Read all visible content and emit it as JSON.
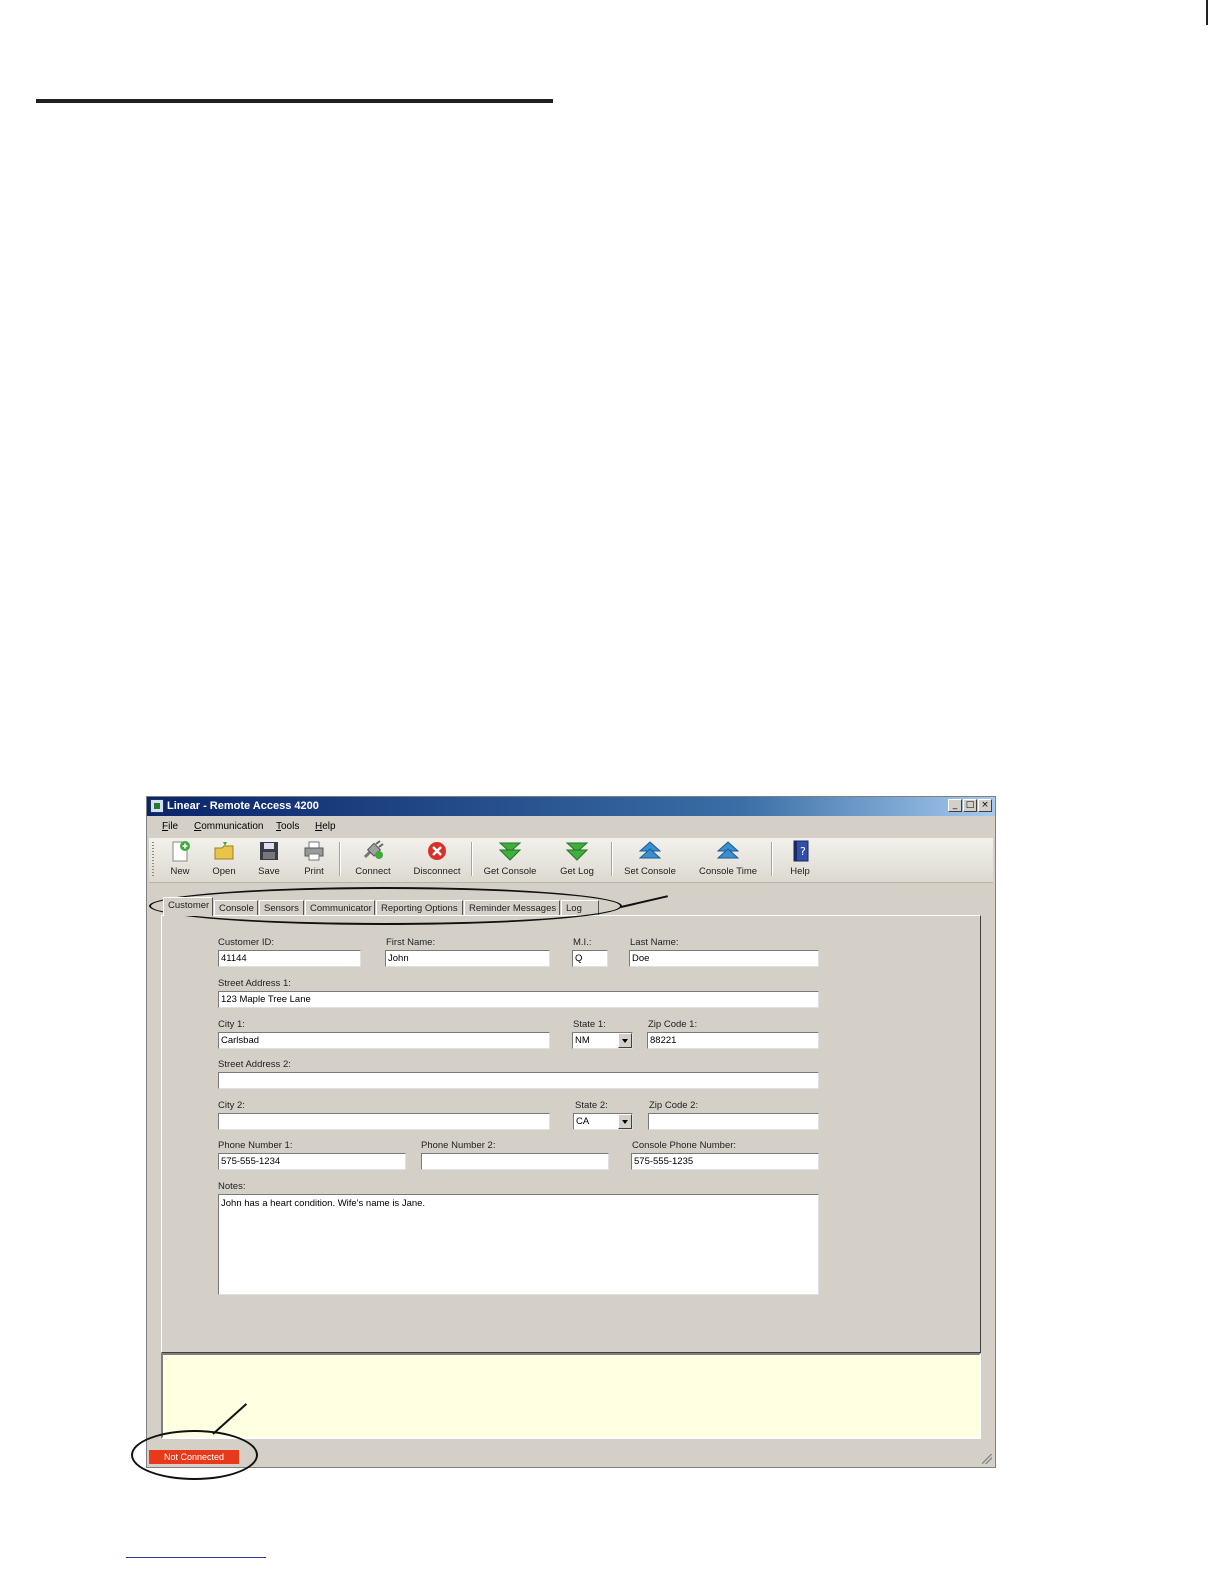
{
  "window": {
    "title": "Linear - Remote Access 4200"
  },
  "menu": [
    {
      "accel": "F",
      "rest": "ile"
    },
    {
      "accel": "C",
      "rest": "ommunication"
    },
    {
      "accel": "T",
      "rest": "ools"
    },
    {
      "accel": "H",
      "rest": "elp"
    }
  ],
  "toolbar": [
    {
      "label": "New",
      "icon": "new-icon"
    },
    {
      "label": "Open",
      "icon": "open-folder-icon"
    },
    {
      "label": "Save",
      "icon": "floppy-disk-icon"
    },
    {
      "label": "Print",
      "icon": "printer-icon"
    },
    {
      "label": "Connect",
      "icon": "plug-icon"
    },
    {
      "label": "Disconnect",
      "icon": "red-x-icon"
    },
    {
      "label": "Get Console",
      "icon": "green-down-arrow-icon"
    },
    {
      "label": "Get Log",
      "icon": "green-down-arrow-icon"
    },
    {
      "label": "Set Console",
      "icon": "blue-up-arrow-icon"
    },
    {
      "label": "Console Time",
      "icon": "blue-up-arrow-icon"
    },
    {
      "label": "Help",
      "icon": "help-book-icon"
    }
  ],
  "tabs": [
    "Customer",
    "Console",
    "Sensors",
    "Communicator",
    "Reporting Options",
    "Reminder Messages",
    "Log"
  ],
  "active_tab": "Customer",
  "form": {
    "customer_id": {
      "label": "Customer ID:",
      "value": "41144"
    },
    "first_name": {
      "label": "First Name:",
      "value": "John"
    },
    "mi": {
      "label": "M.I.:",
      "value": "Q"
    },
    "last_name": {
      "label": "Last Name:",
      "value": "Doe"
    },
    "street1": {
      "label": "Street Address 1:",
      "value": "123 Maple Tree Lane"
    },
    "city1": {
      "label": "City 1:",
      "value": "Carlsbad"
    },
    "state1": {
      "label": "State 1:",
      "value": "NM"
    },
    "zip1": {
      "label": "Zip Code 1:",
      "value": "88221"
    },
    "street2": {
      "label": "Street Address 2:",
      "value": ""
    },
    "city2": {
      "label": "City 2:",
      "value": ""
    },
    "state2": {
      "label": "State 2:",
      "value": "CA"
    },
    "zip2": {
      "label": "Zip Code 2:",
      "value": ""
    },
    "phone1": {
      "label": "Phone Number 1:",
      "value": "575-555-1234"
    },
    "phone2": {
      "label": "Phone Number 2:",
      "value": ""
    },
    "console_phone": {
      "label": "Console Phone Number:",
      "value": "575-555-1235"
    },
    "notes": {
      "label": "Notes:",
      "value": "John has a heart condition. Wife's name is Jane."
    }
  },
  "status": {
    "connection": "Not Connected",
    "color": "#e8391b"
  }
}
